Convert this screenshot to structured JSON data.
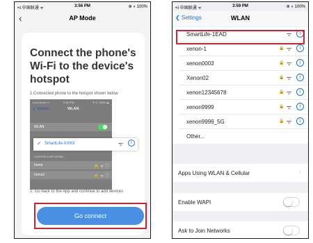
{
  "left": {
    "status": {
      "carrier": "•ıl 中国联通 ᯤ",
      "time": "3:56 PM",
      "battery": "⊕ ◗ 100%"
    },
    "nav": {
      "back": "‹",
      "title": "AP Mode"
    },
    "heading": "Connect the phone's Wi-Fi to the device's hotspot",
    "step1": "1.Connected phone to the hotspot shown below",
    "mock": {
      "carrier": "•••••Carrier ᯤ",
      "time": "2:48 PM",
      "right": "✦ ⊙ 100% ▬",
      "back": "❮ Settings",
      "title": "WLAN",
      "row_wlan": "WLAN",
      "caption": "CHOOSE A NETWORK...",
      "row_home": "home",
      "row_home2": "home2"
    },
    "highlight": {
      "check": "✓",
      "name": "SmartLife-XXXX",
      "wifi": "ᯤ",
      "info": "i"
    },
    "step2": "2. Go back to the App and continue to add devices",
    "button": "Go connect"
  },
  "right": {
    "status": {
      "carrier": "•ıl 中国联通 ᯤ",
      "time": "3:59 PM",
      "battery": "⊕ ◗ 100%"
    },
    "nav": {
      "back": "❮ Settings",
      "title": "WLAN"
    },
    "networks": [
      {
        "name": "SmartLife-1EAD",
        "locked": false
      },
      {
        "name": "xenon-1",
        "locked": true
      },
      {
        "name": "xenon0003",
        "locked": true
      },
      {
        "name": "Xenon02",
        "locked": true
      },
      {
        "name": "xenon12345678",
        "locked": true
      },
      {
        "name": "xenon9999",
        "locked": true
      },
      {
        "name": "xenon9999_5G",
        "locked": true
      }
    ],
    "other": "Other...",
    "apps_wlan": "Apps Using WLAN & Cellular",
    "enable_wapi": "Enable WAPI",
    "ask_join": "Ask to Join Networks",
    "icons": {
      "lock": "🔒",
      "wifi": "ᯤ",
      "info": "i",
      "chevron": "›"
    }
  },
  "colors": {
    "accent": "#4a90e2",
    "link": "#1e6fd9",
    "highlight_border": "#d4202a"
  }
}
